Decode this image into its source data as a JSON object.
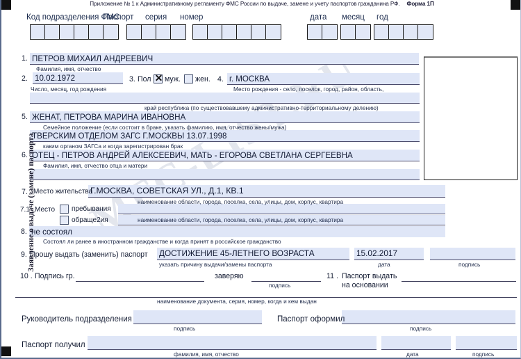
{
  "header": {
    "note": "Приложение № 1 к Административному регламенту ФМС России по выдаче, замене и учету паспортов гражданина РФ.",
    "form_no": "Форма 1П"
  },
  "vertical_title": "Заявление о выдаче (замене) паспорта",
  "watermark": "MFC-LIST.RU",
  "top_row": {
    "code_label": "Код подразделения ФМС",
    "passport_label": "Паспорт",
    "series_label": "серия",
    "number_label": "номер",
    "day_label": "дата",
    "month_label": "месяц",
    "year_label": "год",
    "code_cells": 6,
    "series_cells": 4,
    "number_cells": 6,
    "day_cells": 2,
    "month_cells": 2,
    "year_cells": 4
  },
  "fields": {
    "n1": {
      "num": "1.",
      "value": "ПЕТРОВ МИХАИЛ АНДРЕЕВИЧ",
      "caption": "Фамилия, имя, отчество"
    },
    "n2": {
      "num": "2.",
      "value": "10.02.1972",
      "caption": "Число, месяц, год рождения"
    },
    "n3": {
      "num": "3.",
      "label": "Пол",
      "male_label": "муж.",
      "female_label": "жен.",
      "male_checked": "✕",
      "female_checked": ""
    },
    "n4": {
      "num": "4.",
      "value": "г. МОСКВА",
      "caption": "Место рождения - село, поселок, город, район, область,",
      "caption2": "край республика (по существовавшему административно-территориальному делению)",
      "value2": ""
    },
    "n5": {
      "num": "5.",
      "value": "ЖЕНАТ, ПЕТРОВА МАРИНА ИВАНОВНА",
      "caption": "Семейное положение (если состоит в браке, указать фамилию, имя, отчество жены/мужа)",
      "value2": "ТВЕРСКИМ ОТДЕЛОМ ЗАГС Г.МОСКВЫ 13.07.1998",
      "caption2": "каким органом ЗАГСа и когда зарегистрирован брак"
    },
    "n6": {
      "num": "6.",
      "value": "ОТЕЦ - ПЕТРОВ АНДРЕЙ АЛЕКСЕЕВИЧ, МАТЬ - ЕГОРОВА СВЕТЛАНА СЕРГЕЕВНА",
      "caption": "Фамилия, имя, отчество отца и матери",
      "value2": ""
    },
    "n7": {
      "num": "7.",
      "label": "Место жительства",
      "value": "Г.МОСКВА, СОВЕТСКАЯ УЛ., Д.1, КВ.1",
      "caption": "наименование области, города, поселка, села, улицы, дом, корпус, квартира"
    },
    "n71": {
      "num": "7.1",
      "label": "Место",
      "opt1": "пребывания",
      "opt2": "обраще2ия",
      "value1": "",
      "value2": "",
      "caption": "наименование области, города, поселка, села, улицы, дом, корпус, квартира"
    },
    "n8": {
      "num": "8.",
      "value": "не состоял",
      "caption": "Состоял ли ранее в иностранном гражданстве и когда принят в российское гражданство"
    },
    "n9": {
      "num": "9.",
      "label": "Прошу выдать (заменить) паспорт",
      "value": "ДОСТИЖЕНИЕ 45-ЛЕТНЕГО ВОЗРАСТА",
      "caption": "указать причину выдачи/замены паспорта",
      "date_value": "15.02.2017",
      "date_caption": "дата",
      "sign_value": "",
      "sign_caption": "подпись"
    },
    "n10": {
      "num": "10 .",
      "label": "Подпись гр.",
      "certify_label": "заверяю",
      "sign_caption": "подпись"
    },
    "n11": {
      "num": "11 .",
      "label_line1": "Паспорт выдать",
      "label_line2": "на основании",
      "caption": "наименование документа, серия, номер, когда и кем выдан"
    },
    "chief": {
      "label": "Руководитель подразделения",
      "value": "",
      "caption": "подпись"
    },
    "issued_by": {
      "label": "Паспорт оформил",
      "value": "",
      "caption": "подпись"
    },
    "received": {
      "label": "Паспорт получил",
      "value": "",
      "caption": "фамилия, имя, отчество",
      "date_value": "",
      "date_caption": "дата",
      "sign_value": "",
      "sign_caption": "подпись"
    }
  }
}
